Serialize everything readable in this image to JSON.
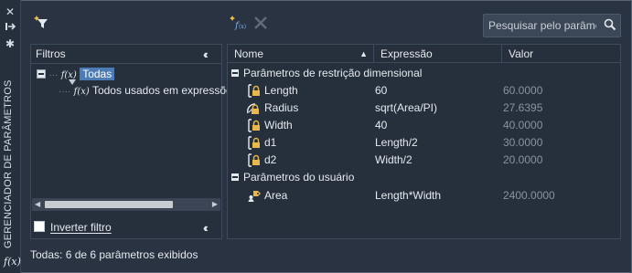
{
  "side_title": "GERENCIADOR DE PARÂMETROS",
  "side_fx": "f(x)",
  "search": {
    "placeholder": "Pesquisar pelo parâmet"
  },
  "filters": {
    "title": "Filtros",
    "tree": [
      {
        "label": "Todas",
        "selected": true
      },
      {
        "label": "Todos usados em expressõe",
        "selected": false
      }
    ],
    "invert_label": "Inverter filtro"
  },
  "grid": {
    "columns": [
      "Nome",
      "Expressão",
      "Valor"
    ],
    "groups": [
      {
        "title": "Parâmetros de restrição dimensional",
        "rows": [
          {
            "name": "Length",
            "expression": "60",
            "value": "60.0000",
            "icon": "linear-lock-icon"
          },
          {
            "name": "Radius",
            "expression": "sqrt(Area/PI)",
            "value": "27.6395",
            "icon": "radial-lock-icon"
          },
          {
            "name": "Width",
            "expression": "40",
            "value": "40.0000",
            "icon": "linear-lock-icon"
          },
          {
            "name": "d1",
            "expression": "Length/2",
            "value": "30.0000",
            "icon": "linear-lock-icon"
          },
          {
            "name": "d2",
            "expression": "Width/2",
            "value": "20.0000",
            "icon": "linear-lock-icon"
          }
        ]
      },
      {
        "title": "Parâmetros do usuário",
        "rows": [
          {
            "name": "Area",
            "expression": "Length*Width",
            "value": "2400.0000",
            "icon": "user-parameter-icon"
          }
        ]
      }
    ]
  },
  "status": "Todas: 6 de 6 parâmetros exibidos"
}
